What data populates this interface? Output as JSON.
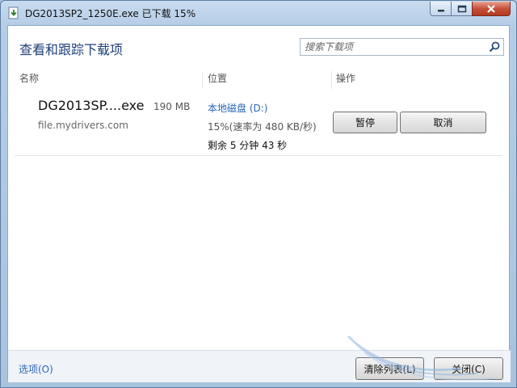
{
  "window": {
    "title": "DG2013SP2_1250E.exe 已下载 15%"
  },
  "header": {
    "title": "查看和跟踪下载项",
    "search_placeholder": "搜索下载项"
  },
  "columns": {
    "name": "名称",
    "location": "位置",
    "action": "操作"
  },
  "download": {
    "file_name": "DG2013SP....exe",
    "file_size": "190 MB",
    "source": "file.mydrivers.com",
    "location": "本地磁盘 (D:)",
    "progress_text": "15%(速率为 480 KB/秒)",
    "remaining_text": "剩余 5 分钟 43 秒",
    "progress": 15,
    "pause_label": "暂停",
    "cancel_label": "取消"
  },
  "footer": {
    "options_label": "选项(O)",
    "clear_label": "清除列表(L)",
    "close_label": "关闭(C)"
  },
  "icons": {
    "title": "download-file-icon",
    "search": "search-icon",
    "minimize": "minimize-icon",
    "maximize": "maximize-icon",
    "close": "close-icon"
  },
  "colors": {
    "accent_link": "#2a66b8",
    "heading": "#1e3f7a",
    "close_button": "#c7513a"
  }
}
